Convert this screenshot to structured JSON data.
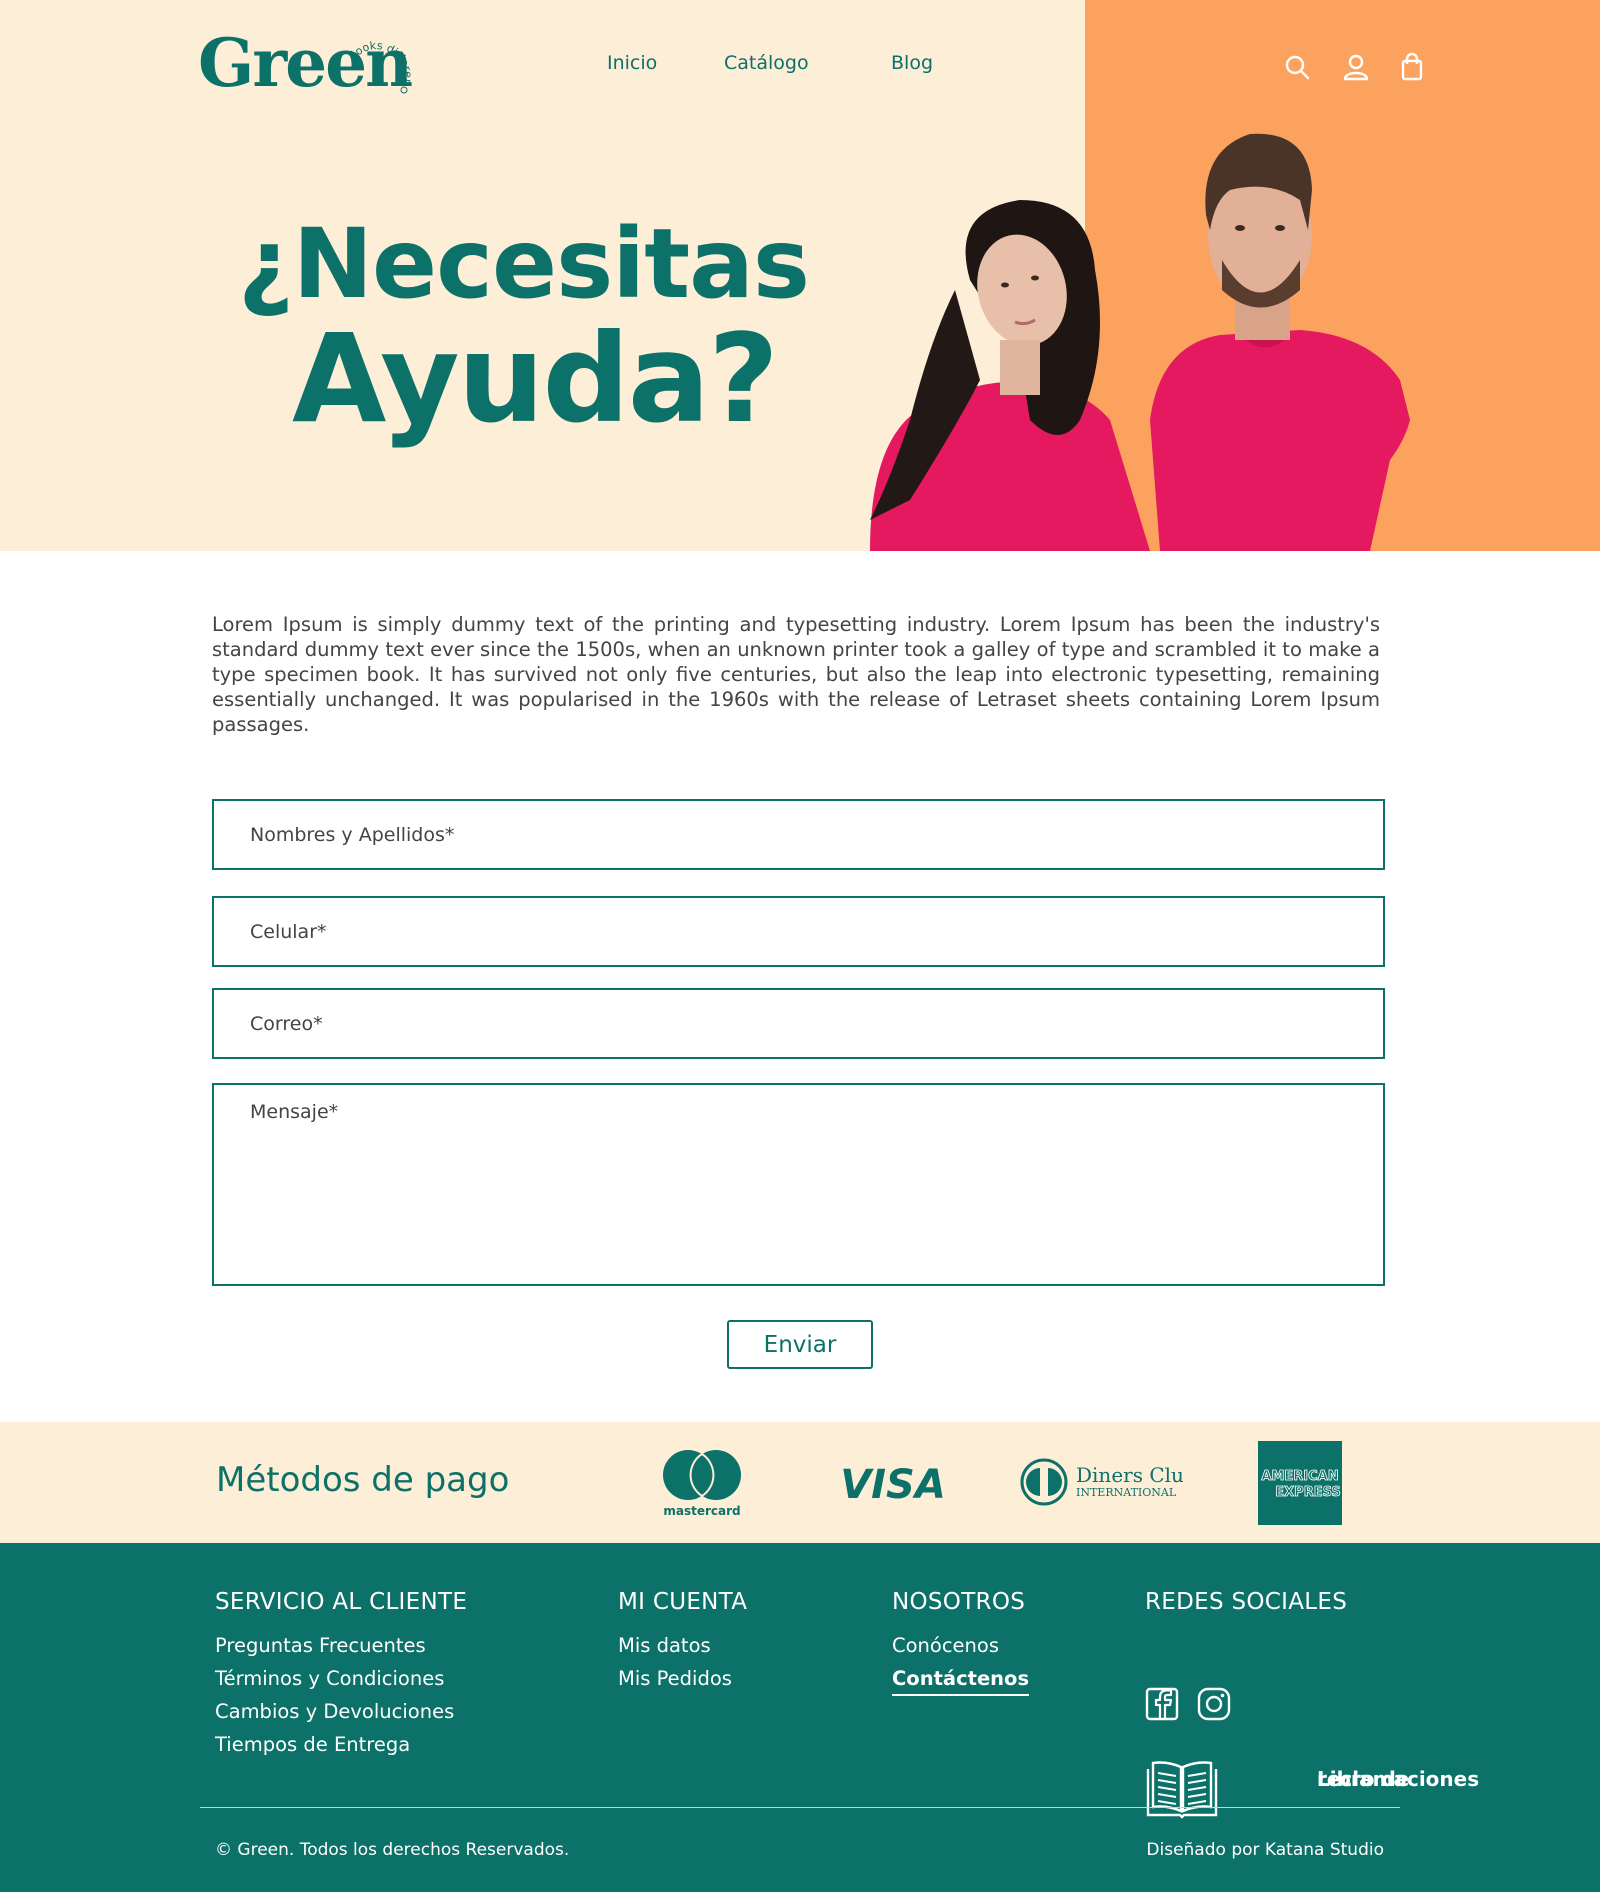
{
  "header": {
    "logo": {
      "word": "Green",
      "tagline": "looks different"
    },
    "nav": [
      "Inicio",
      "Catálogo",
      "Blog"
    ],
    "icons": [
      "search-icon",
      "user-icon",
      "shopping-bag-icon"
    ]
  },
  "hero": {
    "title_line1": "¿Necesitas",
    "title_line2": "Ayuda?",
    "image": "couple-in-pink-shirts"
  },
  "intro": "Lorem Ipsum is simply dummy text of the printing and typesetting industry. Lorem Ipsum has been the industry's standard dummy text ever since the 1500s, when an unknown printer took a galley of type and scrambled it to make a type specimen book. It has survived not only five centuries, but also the leap into electronic typesetting, remaining essentially unchanged. It was popularised in the 1960s with the release of Letraset sheets containing Lorem Ipsum passages.",
  "form": {
    "name_placeholder": "Nombres y Apellidos*",
    "phone_placeholder": "Celular*",
    "email_placeholder": "Correo*",
    "message_placeholder": "Mensaje*",
    "submit_label": "Enviar"
  },
  "payment": {
    "title": "Métodos de pago",
    "methods": {
      "mastercard": "mastercard",
      "visa": "VISA",
      "diners_line1": "Diners Club",
      "diners_line2": "INTERNATIONAL",
      "amex_line1": "AMERICAN",
      "amex_line2": "EXPRESS"
    }
  },
  "footer": {
    "service": {
      "title": "SERVICIO AL CLIENTE",
      "links": [
        "Preguntas Frecuentes",
        "Términos y Condiciones",
        "Cambios y Devoluciones",
        "Tiempos de Entrega"
      ]
    },
    "account": {
      "title": "MI CUENTA",
      "links": [
        "Mis datos",
        "Mis Pedidos"
      ]
    },
    "about": {
      "title": "NOSOTROS",
      "links": [
        "Conócenos",
        "Contáctenos"
      ]
    },
    "social": {
      "title": "REDES SOCIALES",
      "icons": [
        "facebook-icon",
        "instagram-icon"
      ],
      "book_label_line1": "Libro de",
      "book_label_line2": "reclamaciones"
    },
    "copyright": "© Green. Todos los derechos Reservados.",
    "credit": "Diseñado por Katana Studio"
  },
  "colors": {
    "primary": "#0c7168",
    "cream": "#fdeed8",
    "orange": "#fba35e",
    "shirt_pink": "#e5195f"
  }
}
